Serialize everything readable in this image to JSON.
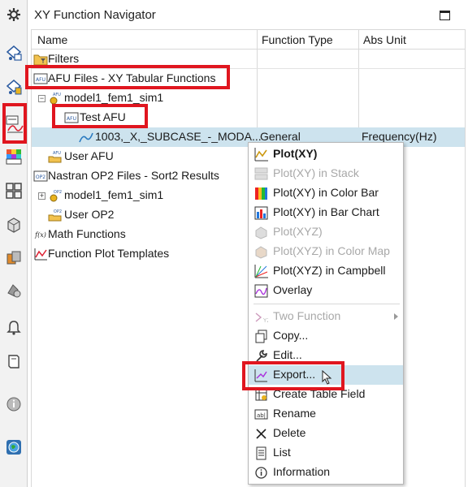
{
  "navigator": {
    "title": "XY Function Navigator",
    "columns": {
      "name": "Name",
      "type": "Function Type",
      "unit": "Abs Unit"
    }
  },
  "tree": [
    {
      "label": "Filters",
      "icon": "filter-icon"
    },
    {
      "label": "AFU Files - XY Tabular Functions",
      "icon": "afu-icon"
    },
    {
      "label": "model1_fem1_sim1",
      "icon": "afu-file-icon"
    },
    {
      "label": "Test AFU",
      "icon": "afu-icon"
    },
    {
      "label": "1003,_X,_SUBCASE_-_MODA...",
      "type": "General",
      "unit": "Frequency(Hz)",
      "icon": "curve-icon"
    },
    {
      "label": "User AFU",
      "icon": "afu-folder-icon"
    },
    {
      "label": "Nastran OP2 Files - Sort2 Results",
      "icon": "op2-icon"
    },
    {
      "label": "model1_fem1_sim1",
      "icon": "op2-file-icon"
    },
    {
      "label": "User OP2",
      "icon": "op2-folder-icon"
    },
    {
      "label": "Math Functions",
      "icon": "fx-icon"
    },
    {
      "label": "Function Plot Templates",
      "icon": "template-icon"
    }
  ],
  "menu": [
    {
      "label": "Plot(XY)",
      "icon": "plot-xy-icon",
      "bold": true
    },
    {
      "label": "Plot(XY) in Stack",
      "icon": "stack-icon",
      "disabled": true
    },
    {
      "label": "Plot(XY) in Color Bar",
      "icon": "color-bar-icon"
    },
    {
      "label": "Plot(XY) in Bar Chart",
      "icon": "bar-chart-icon"
    },
    {
      "label": "Plot(XYZ)",
      "icon": "plot-xyz-icon",
      "disabled": true
    },
    {
      "label": "Plot(XYZ) in Color Map",
      "icon": "color-map-icon",
      "disabled": true
    },
    {
      "label": "Plot(XYZ) in Campbell",
      "icon": "campbell-icon"
    },
    {
      "label": "Overlay",
      "icon": "overlay-icon"
    },
    {
      "label": "Two Function",
      "icon": "two-function-icon",
      "disabled": true,
      "submenu": true
    },
    {
      "label": "Copy...",
      "icon": "copy-icon"
    },
    {
      "label": "Edit...",
      "icon": "wrench-icon"
    },
    {
      "label": "Export...",
      "icon": "export-icon",
      "highlighted": true
    },
    {
      "label": "Create Table Field",
      "icon": "table-field-icon"
    },
    {
      "label": "Rename",
      "icon": "rename-icon"
    },
    {
      "label": "Delete",
      "icon": "delete-icon"
    },
    {
      "label": "List",
      "icon": "list-icon"
    },
    {
      "label": "Information",
      "icon": "info-icon"
    }
  ],
  "colors": {
    "highlight": "#e0161f",
    "selection": "#cde3ee"
  }
}
